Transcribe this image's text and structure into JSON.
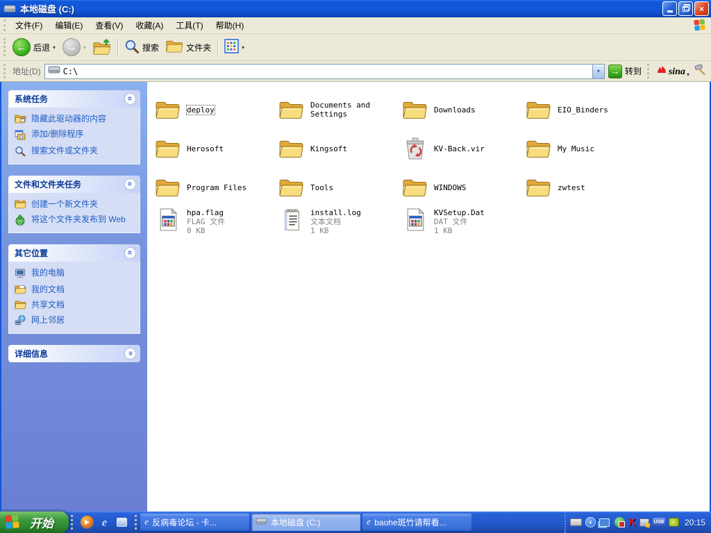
{
  "window": {
    "title": "本地磁盘 (C:)",
    "controls": {
      "close_glyph": "×"
    }
  },
  "menu": {
    "items": [
      "文件(F)",
      "编辑(E)",
      "查看(V)",
      "收藏(A)",
      "工具(T)",
      "帮助(H)"
    ]
  },
  "toolbar": {
    "back_label": "后退",
    "back_glyph": "←",
    "forward_glyph": "→",
    "search_label": "搜索",
    "folders_label": "文件夹",
    "caret": "▾"
  },
  "address": {
    "label": "地址(D)",
    "value": "C:\\",
    "drop_glyph": "▾",
    "go_glyph": "→",
    "go_label": "转到",
    "sina_label": "sina"
  },
  "sidebar": {
    "panels": [
      {
        "title": "系统任务",
        "collapse_glyph": "«",
        "items": [
          {
            "label": "隐藏此驱动器的内容"
          },
          {
            "label": "添加/删除程序"
          },
          {
            "label": "搜索文件或文件夹"
          }
        ]
      },
      {
        "title": "文件和文件夹任务",
        "collapse_glyph": "«",
        "items": [
          {
            "label": "创建一个新文件夹"
          },
          {
            "label": "将这个文件夹发布到 Web"
          }
        ]
      },
      {
        "title": "其它位置",
        "collapse_glyph": "«",
        "items": [
          {
            "label": "我的电脑"
          },
          {
            "label": "我的文档"
          },
          {
            "label": "共享文档"
          },
          {
            "label": "网上邻居"
          }
        ]
      },
      {
        "title": "详细信息",
        "collapse_glyph": "«",
        "items": []
      }
    ]
  },
  "files": {
    "items": [
      {
        "name": "deploy",
        "icon": "folder",
        "selected": true
      },
      {
        "name": "Documents and Settings",
        "icon": "folder"
      },
      {
        "name": "Downloads",
        "icon": "folder"
      },
      {
        "name": "EIO_Binders",
        "icon": "folder"
      },
      {
        "name": "Herosoft",
        "icon": "folder"
      },
      {
        "name": "Kingsoft",
        "icon": "folder"
      },
      {
        "name": "KV-Back.vir",
        "icon": "recycle-bin"
      },
      {
        "name": "My Music",
        "icon": "folder"
      },
      {
        "name": "Program Files",
        "icon": "folder"
      },
      {
        "name": "Tools",
        "icon": "folder"
      },
      {
        "name": "WINDOWS",
        "icon": "folder"
      },
      {
        "name": "zwtest",
        "icon": "folder"
      },
      {
        "name": "hpa.flag",
        "icon": "system-file",
        "type": "FLAG 文件",
        "size": "0 KB"
      },
      {
        "name": "install.log",
        "icon": "text-file",
        "type": "文本文档",
        "size": "1 KB"
      },
      {
        "name": "KVSetup.Dat",
        "icon": "system-file",
        "type": "DAT 文件",
        "size": "1 KB"
      }
    ]
  },
  "taskbar": {
    "start_label": "开始",
    "quicklaunch": {
      "wmp_glyph": "▶",
      "ie_glyph": "e"
    },
    "tasks": [
      {
        "label": "反病毒论坛 - 卡...",
        "icon": "ie"
      },
      {
        "label": "本地磁盘 (C:)",
        "icon": "disk",
        "active": true
      },
      {
        "label": "baohe斑竹请帮看...",
        "icon": "ie"
      }
    ],
    "tray": {
      "hide_glyph": "‹",
      "kaspersky_label": "K",
      "usb_label": "USB",
      "clock": "20:15"
    }
  }
}
